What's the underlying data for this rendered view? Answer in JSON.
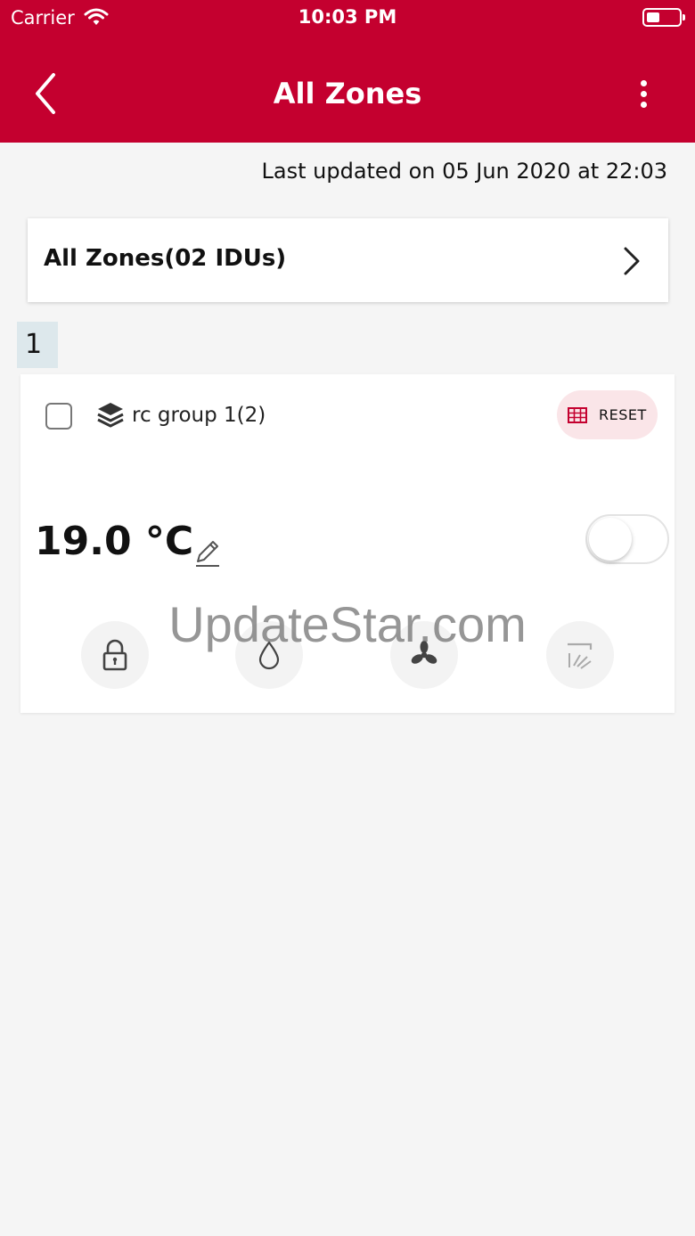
{
  "status_bar": {
    "carrier": "Carrier",
    "time": "10:03 PM"
  },
  "header": {
    "title": "All Zones",
    "back_icon": "chevron-left-icon",
    "menu_icon": "more-vertical-icon"
  },
  "last_updated": "Last updated on 05 Jun 2020 at 22:03",
  "zones_summary": {
    "label": "All Zones(02 IDUs)",
    "icon": "chevron-right-icon"
  },
  "group": {
    "number": "1",
    "name": "rc group 1(2)",
    "checked": false,
    "reset_label": "RESET",
    "temperature": "19.0 °C",
    "power_on": false,
    "mode_buttons": [
      "lock-icon",
      "water-drop-icon",
      "fan-icon",
      "swing-icon"
    ]
  },
  "watermark": "UpdateStar.com",
  "colors": {
    "brand": "#c4002f",
    "background": "#f5f5f5",
    "reset_bg": "#fae5e8",
    "group_number_bg": "#dde8ec"
  }
}
